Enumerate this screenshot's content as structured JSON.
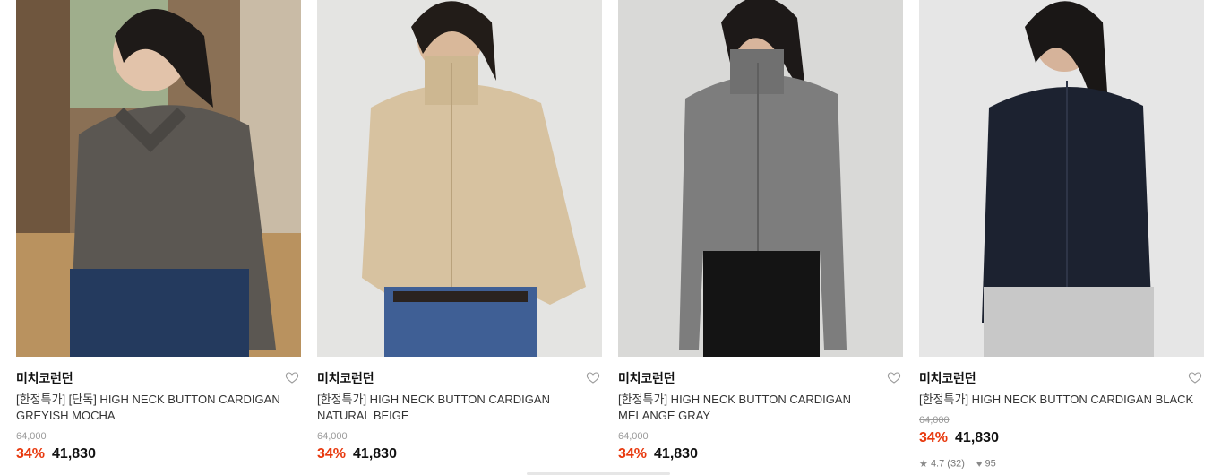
{
  "colors": {
    "discount": "#e8380d",
    "price": "#111111",
    "original_price": "#9a9a9a"
  },
  "products": [
    {
      "brand": "미치코런던",
      "title": "[한정특가] [단독] HIGH NECK BUTTON CARDIGAN GREYISH MOCHA",
      "original_price": "64,000",
      "discount": "34%",
      "price": "41,830",
      "wishlist_icon": "heart-outline-icon",
      "image_colors": {
        "background": "#8a7055",
        "garment": "#5b5752"
      }
    },
    {
      "brand": "미치코런던",
      "title": "[한정특가] HIGH NECK BUTTON CARDIGAN NATURAL BEIGE",
      "original_price": "64,000",
      "discount": "34%",
      "price": "41,830",
      "wishlist_icon": "heart-outline-icon",
      "image_colors": {
        "background": "#e4e4e2",
        "garment": "#d7c2a0"
      }
    },
    {
      "brand": "미치코런던",
      "title": "[한정특가] HIGH NECK BUTTON CARDIGAN MELANGE GRAY",
      "original_price": "64,000",
      "discount": "34%",
      "price": "41,830",
      "wishlist_icon": "heart-outline-icon",
      "image_colors": {
        "background": "#d9d9d7",
        "garment": "#7d7d7d"
      }
    },
    {
      "brand": "미치코런던",
      "title": "[한정특가] HIGH NECK BUTTON CARDIGAN BLACK",
      "original_price": "64,000",
      "discount": "34%",
      "price": "41,830",
      "wishlist_icon": "heart-outline-icon",
      "image_colors": {
        "background": "#e6e6e6",
        "garment": "#1c2230"
      },
      "rating": "4.7",
      "review_count": "(32)",
      "likes": "95"
    }
  ]
}
